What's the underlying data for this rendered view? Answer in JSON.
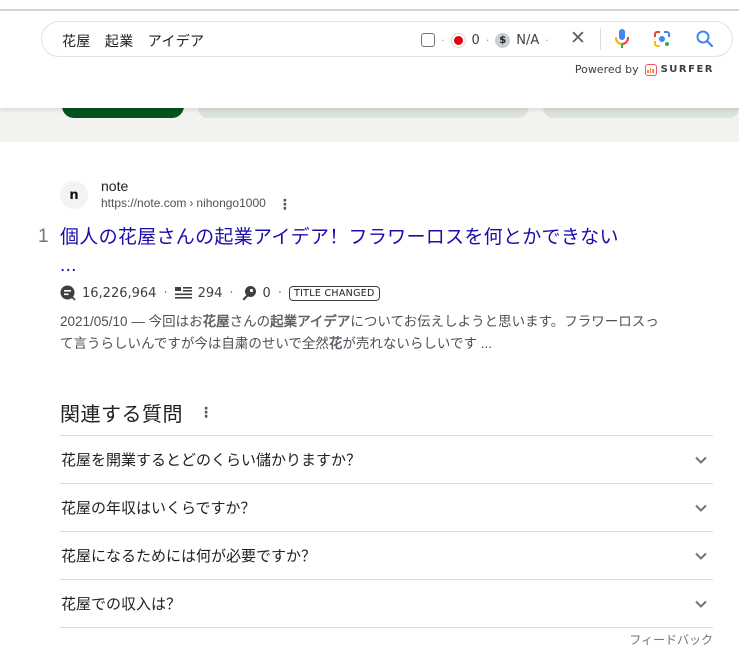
{
  "search": {
    "query": "花屋　起業　アイデア",
    "extension": {
      "checkbox_checked": false,
      "record_count": "0",
      "cpc": "N/A"
    },
    "icons": [
      "checkbox-icon",
      "record-icon",
      "dollar-icon",
      "close-icon",
      "microphone-icon",
      "lens-icon",
      "search-icon"
    ],
    "powered_by_label": "Powered by",
    "powered_by_brand": "SURFER"
  },
  "result": {
    "rank": "1",
    "site_name": "note",
    "favicon_letter": "n",
    "url": "https://note.com",
    "url_path": "nihongo1000",
    "breadcrumb_sep": "›",
    "title_line1": "個人の花屋さんの起業アイデア！フラワーロスを何とかできない",
    "title_line2": "...",
    "metrics": {
      "traffic": "16,226,964",
      "words": "294",
      "keywords": "0",
      "badge": "TITLE CHANGED"
    },
    "snippet": {
      "date": "2021/05/10",
      "dash": " — ",
      "parts": [
        {
          "text": "今回はお",
          "bold": false
        },
        {
          "text": "花屋",
          "bold": true
        },
        {
          "text": "さんの",
          "bold": false
        },
        {
          "text": "起業アイデア",
          "bold": true
        },
        {
          "text": "についてお伝えしようと思います。フラワーロスって言うらしいんですが今は自粛のせいで全然",
          "bold": false
        },
        {
          "text": "花",
          "bold": true
        },
        {
          "text": "が売れないらしいです ...",
          "bold": false
        }
      ]
    }
  },
  "paa": {
    "title": "関連する質問",
    "questions": [
      "花屋を開業するとどのくらい儲かりますか？",
      "花屋の年収はいくらですか？",
      "花屋になるためには何が必要ですか？",
      "花屋での収入は？"
    ],
    "feedback_label": "フィードバック"
  },
  "colors": {
    "link": "#1a0dab",
    "active_chip": "#02531f",
    "chip": "#dbe2d8",
    "chipbar_bg": "#f2f3ee",
    "record_dot": "#e3000f"
  }
}
